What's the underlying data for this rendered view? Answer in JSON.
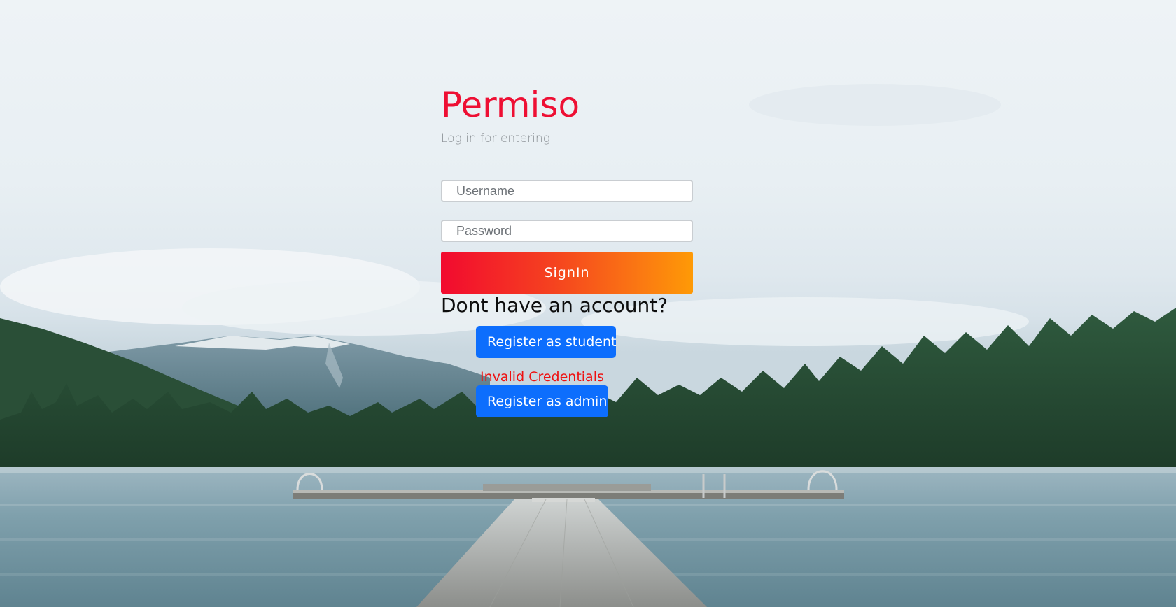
{
  "brand": {
    "title": "Permiso",
    "subtitle": "Log in for entering"
  },
  "form": {
    "username_placeholder": "Username",
    "password_placeholder": "Password",
    "signin_label": "SignIn",
    "error_message": "Invalid Credentials"
  },
  "register": {
    "question": "Dont have an account?",
    "student_label": "Register as student",
    "admin_label": "Register as admin"
  },
  "colors": {
    "brand": "#ee0f33",
    "signin_gradient_start": "#f20a2f",
    "signin_gradient_end": "#fe9a06",
    "register_button": "#0d6efd",
    "error": "#ee1111"
  },
  "background": {
    "image": "lake-dock-mountain-forest-photo"
  }
}
